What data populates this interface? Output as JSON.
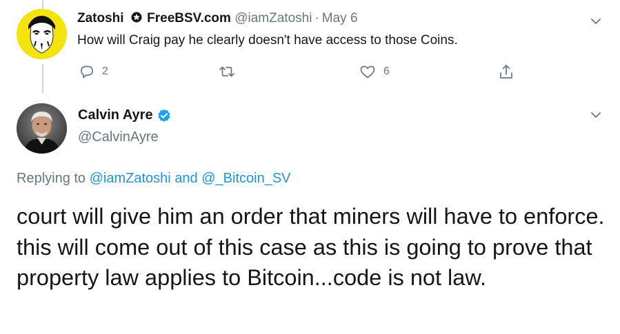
{
  "tweet1": {
    "name": "Zatoshi",
    "name_suffix": "FreeBSV.com",
    "handle": "@iamZatoshi",
    "separator": "·",
    "date": "May 6",
    "text": "How will Craig pay he clearly doesn't have access to those Coins.",
    "replies": "2",
    "likes": "6"
  },
  "tweet2": {
    "name": "Calvin Ayre",
    "handle": "@CalvinAyre",
    "replying_prefix": "Replying to",
    "replying_user1": "@iamZatoshi",
    "replying_and": "and",
    "replying_user2": "@_Bitcoin_SV",
    "text": "court will give him an order that miners will have to enforce.  this will come out of this case as this is going to prove that property law applies to Bitcoin...code is not law."
  },
  "colors": {
    "text": "#14171a",
    "secondary": "#657786",
    "link": "#1b95e0",
    "verified": "#1da1f2",
    "thread_line": "#ccd6dd",
    "avatar1_bg": "#f4e30c"
  },
  "icons": [
    "reply-icon",
    "retweet-icon",
    "like-icon",
    "share-icon",
    "chevron-down-icon",
    "verified-badge-icon",
    "star-badge-icon"
  ]
}
